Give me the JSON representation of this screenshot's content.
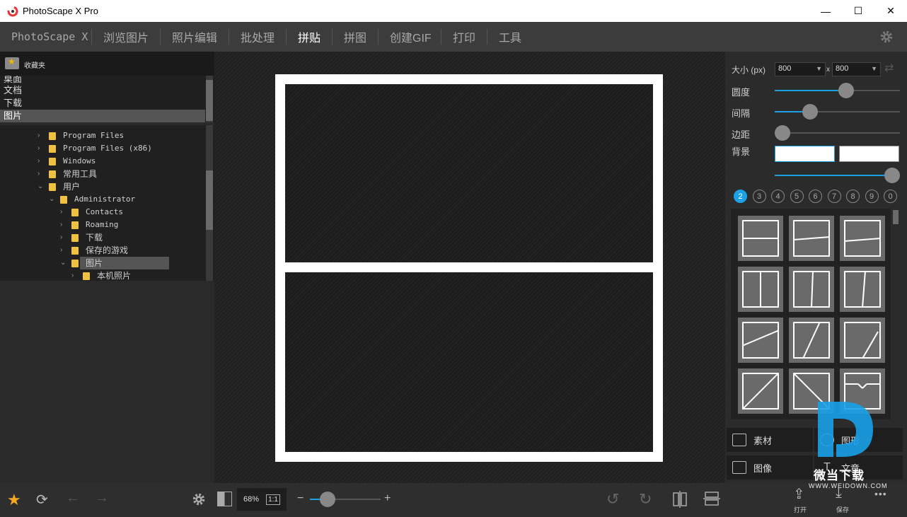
{
  "window": {
    "title": "PhotoScape X Pro",
    "minimize": "—",
    "maximize": "☐",
    "close": "✕"
  },
  "menu": {
    "items": [
      "PhotoScape X",
      "浏览图片",
      "照片编辑",
      "批处理",
      "拼贴",
      "拼图",
      "创建GIF",
      "打印",
      "工具"
    ],
    "active": "拼贴"
  },
  "left": {
    "favorites_label": "收藏夹",
    "favorites": [
      "桌面",
      "文档",
      "下载",
      "图片"
    ],
    "selected_favorite": "图片",
    "tree": [
      {
        "label": "Program Files",
        "level": 0,
        "expanded": false
      },
      {
        "label": "Program Files (x86)",
        "level": 0,
        "expanded": false
      },
      {
        "label": "Windows",
        "level": 0,
        "expanded": false
      },
      {
        "label": "常用工具",
        "level": 0,
        "expanded": false
      },
      {
        "label": "用户",
        "level": 0,
        "expanded": true
      },
      {
        "label": "Administrator",
        "level": 1,
        "expanded": true
      },
      {
        "label": "Contacts",
        "level": 2,
        "expanded": false
      },
      {
        "label": "Roaming",
        "level": 2,
        "expanded": false
      },
      {
        "label": "下载",
        "level": 2,
        "expanded": false
      },
      {
        "label": "保存的游戏",
        "level": 2,
        "expanded": false
      },
      {
        "label": "图片",
        "level": 2,
        "expanded": true,
        "selected": true
      },
      {
        "label": "本机照片",
        "level": 3,
        "expanded": false
      }
    ]
  },
  "right": {
    "size_label": "大小 (px)",
    "width_value": "800",
    "x_sep": "x",
    "height_value": "800",
    "roundness_label": "圆度",
    "roundness": 0.57,
    "spacing_label": "间隔",
    "spacing": 0.28,
    "margin_label": "边距",
    "margin": 0.0,
    "background_label": "背景",
    "opacity": 1.0,
    "photo_counts": [
      "2",
      "3",
      "4",
      "5",
      "6",
      "7",
      "8",
      "9",
      "0"
    ],
    "active_count": "2",
    "buttons": {
      "materials": "素材",
      "shape": "图形",
      "image": "图像",
      "text": "文章"
    },
    "accent_color": "#1da1e6"
  },
  "bottom": {
    "zoom": "68%",
    "ratio": "1:1",
    "zoom_level": 0.25,
    "minus": "−",
    "plus": "+",
    "open_label": "打开",
    "save_label": "保存",
    "more": "•••"
  },
  "watermark": {
    "brand": "微当下载",
    "url": "WWW.WEIDOWN.COM"
  }
}
